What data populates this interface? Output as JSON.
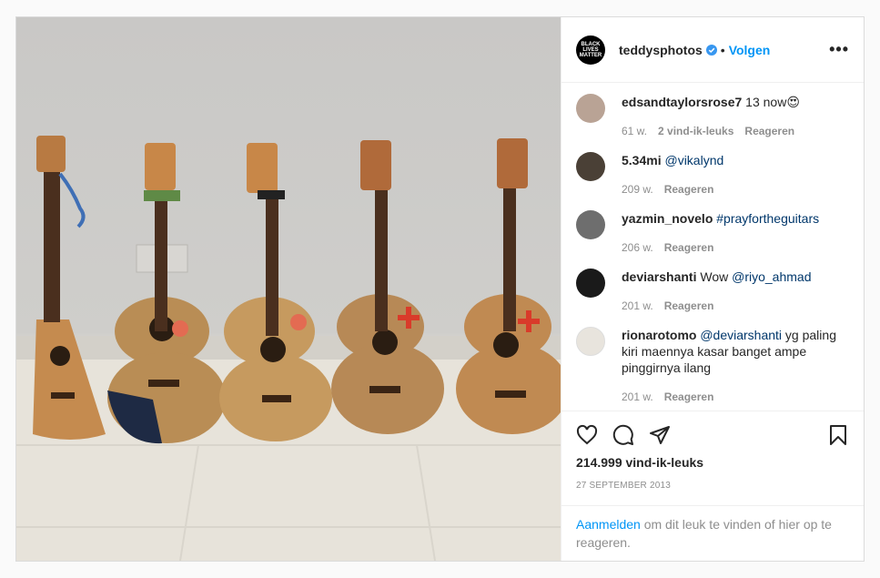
{
  "header": {
    "avatar_text": "BLACK LIVES MATTER",
    "username": "teddysphotos",
    "separator": "•",
    "follow_label": "Volgen",
    "more_label": "•••"
  },
  "comments": [
    {
      "user": "edsandtaylorsrose7",
      "text": " 13 now😍",
      "tag": "",
      "age": "61 w.",
      "likes": "2 vind-ik-leuks",
      "reply": "Reageren",
      "avatar_color": "#b9a395"
    },
    {
      "user": "5.34mi",
      "text": " ",
      "tag": "@vikalynd",
      "age": "209 w.",
      "likes": "",
      "reply": "Reageren",
      "avatar_color": "#4a4036"
    },
    {
      "user": "yazmin_novelo",
      "text": " ",
      "tag": "#prayfortheguitars",
      "age": "206 w.",
      "likes": "",
      "reply": "Reageren",
      "avatar_color": "#6e6e6e"
    },
    {
      "user": "deviarshanti",
      "text": " Wow ",
      "tag": "@riyo_ahmad",
      "age": "201 w.",
      "likes": "",
      "reply": "Reageren",
      "avatar_color": "#1a1a1a"
    },
    {
      "user": "rionarotomo",
      "text": " yg paling kiri maennya kasar banget ampe pinggirnya ilang",
      "tag": " @deviarshanti",
      "age": "201 w.",
      "likes": "",
      "reply": "Reageren",
      "avatar_color": "#e8e4dd"
    }
  ],
  "actions": {
    "like_icon": "heart-icon",
    "comment_icon": "comment-icon",
    "share_icon": "paper-plane-icon",
    "save_icon": "bookmark-icon",
    "likes_count": "214.999 vind-ik-leuks",
    "date": "27 september 2013"
  },
  "login": {
    "link": "Aanmelden",
    "text": " om dit leuk te vinden of hier op te reageren."
  },
  "colors": {
    "link_blue": "#0095f6",
    "tag_blue": "#00376b",
    "muted": "#8e8e8e"
  }
}
